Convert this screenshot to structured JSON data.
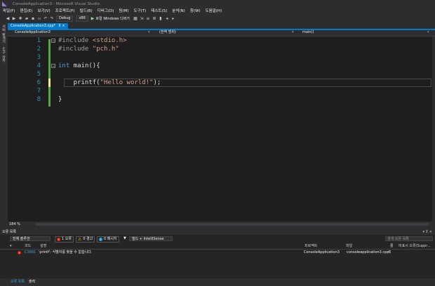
{
  "window": {
    "title": "ConsoleApplication3 - Microsoft Visual Studio"
  },
  "menu": [
    "파일(F)",
    "편집(E)",
    "보기(V)",
    "프로젝트(P)",
    "빌드(B)",
    "디버그(D)",
    "팀(M)",
    "도구(T)",
    "테스트(S)",
    "분석(N)",
    "창(W)",
    "도움말(H)"
  ],
  "toolbar": {
    "config": "Debug",
    "platform": "x86",
    "run_label": "로컬 Windows 디버거"
  },
  "sidebar": {
    "labels": [
      "서버 탐색기",
      "도구 상자"
    ]
  },
  "tab": {
    "name": "ConsoleApplication3.cpp*",
    "pin": "⊼ ×"
  },
  "navbar": {
    "project": "ConsoleApplication3",
    "scope": "(전역 범위)",
    "member": "main()"
  },
  "editor": {
    "line_numbers": [
      "1",
      "2",
      "3",
      "4",
      "5",
      "6",
      "7",
      "8"
    ],
    "lines": {
      "l1_directive": "#include ",
      "l1_header": "<stdio.h>",
      "l2_directive": "#include ",
      "l2_header": "\"pch.h\"",
      "l4_type": "int",
      "l4_rest": " main(){",
      "l6_indent": "    printf(",
      "l6_string": "\"Hello world!\"",
      "l6_rest": ");",
      "l8": "}"
    },
    "zoom": "184 %"
  },
  "error_list": {
    "title": "오류 목록",
    "scope": "전체 솔루션",
    "errors_label": "1 오류",
    "warnings_label": "0 경고",
    "messages_label": "0 메시지",
    "build_filter": "빌드 + IntelliSense",
    "search_placeholder": "검색 오류 목록",
    "columns": {
      "code": "코드",
      "description": "설명",
      "project": "프로젝트",
      "file": "파일",
      "line": "줄",
      "suppression": "비표시 오류(Suppr..."
    },
    "row": {
      "code": "C3861",
      "description": "'printf': 식별자를 찾을 수 없습니다.",
      "project": "ConsoleApplication3",
      "file": "consoleapplication3.cpp",
      "line": "6"
    }
  },
  "bottom_tabs": [
    "오류 목록",
    "출력"
  ],
  "colors": {
    "accent": "#007acc",
    "error": "#e51400"
  }
}
